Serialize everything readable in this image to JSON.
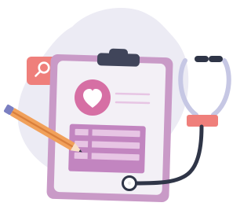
{
  "illustration": {
    "subject": "medical-checkup",
    "icons": [
      "search-icon",
      "heart-icon",
      "clipboard-icon",
      "pencil-icon",
      "stethoscope-icon"
    ],
    "colors": {
      "background_blob": "#ecebf4",
      "clipboard_border": "#c99ac7",
      "clipboard_paper": "#f3f0f6",
      "clipboard_clip": "#40455a",
      "heart_circle": "#d66fa4",
      "heart": "#ffffff",
      "form_block": "#c285c0",
      "form_lines": "#e7c5e4",
      "search_badge": "#ef7f7b",
      "pencil_body": "#f1a15b",
      "pencil_stripe": "#d97f3c",
      "pencil_tip": "#f8e0c7",
      "pencil_cap": "#7b7fc1",
      "stethoscope_tube": "#2f3547",
      "stethoscope_headset": "#c6c7e4",
      "stethoscope_band": "#ef7f7b",
      "stethoscope_chest": "#ffffff"
    }
  }
}
